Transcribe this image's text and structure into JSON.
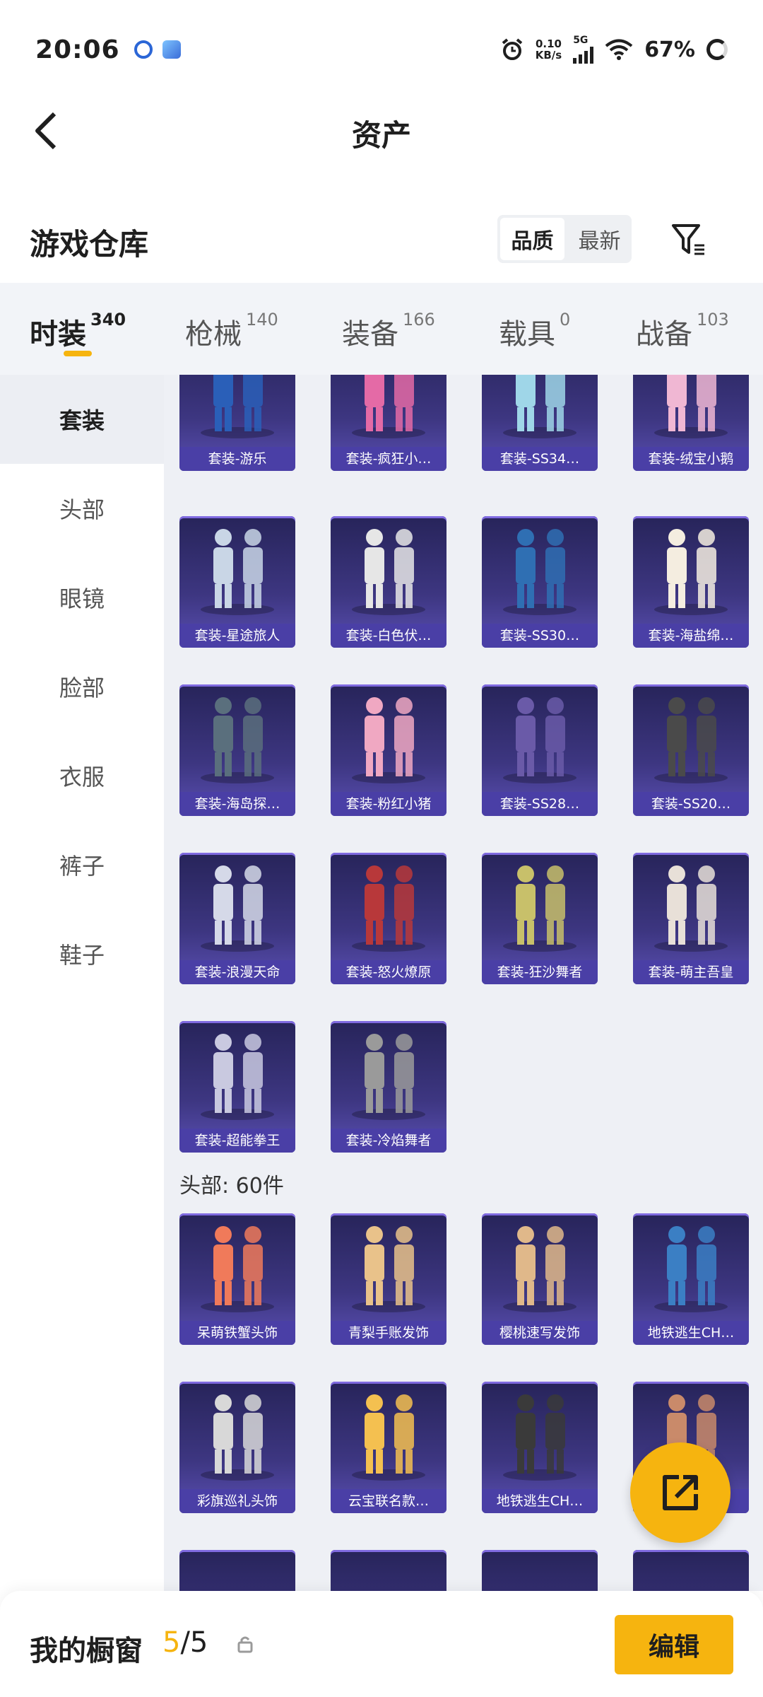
{
  "status_bar": {
    "time": "20:06",
    "net_speed_value": "0.10",
    "net_speed_unit": "KB/s",
    "network": "5G",
    "battery": "67%",
    "icons": [
      "app-notification-icon",
      "app-avatar-icon",
      "alarm-icon",
      "signal-icon",
      "wifi-icon",
      "battery-icon"
    ]
  },
  "nav": {
    "title": "资产",
    "back_icon": "chevron-left-icon"
  },
  "warehouse": {
    "title": "游戏仓库",
    "sort_options": [
      {
        "label": "品质",
        "active": true
      },
      {
        "label": "最新",
        "active": false
      }
    ],
    "filter_icon": "filter-icon"
  },
  "tabs": [
    {
      "label": "时装",
      "count": "340",
      "active": true
    },
    {
      "label": "枪械",
      "count": "140",
      "active": false
    },
    {
      "label": "装备",
      "count": "166",
      "active": false
    },
    {
      "label": "载具",
      "count": "0",
      "active": false
    },
    {
      "label": "战备",
      "count": "103",
      "active": false
    }
  ],
  "sidebar": {
    "items": [
      {
        "label": "套装",
        "active": true
      },
      {
        "label": "头部",
        "active": false
      },
      {
        "label": "眼镜",
        "active": false
      },
      {
        "label": "脸部",
        "active": false
      },
      {
        "label": "衣服",
        "active": false
      },
      {
        "label": "裤子",
        "active": false
      },
      {
        "label": "鞋子",
        "active": false
      }
    ]
  },
  "suits": [
    "套装-游乐",
    "套装-疯狂小…",
    "套装-SS34…",
    "套装-绒宝小鹅",
    "套装-星途旅人",
    "套装-白色伏…",
    "套装-SS30…",
    "套装-海盐绵…",
    "套装-海岛探…",
    "套装-粉红小猪",
    "套装-SS28…",
    "套装-SS20…",
    "套装-浪漫天命",
    "套装-怒火燎原",
    "套装-狂沙舞者",
    "套装-萌主吾皇",
    "套装-超能拳王",
    "套装-冷焰舞者"
  ],
  "head_section": {
    "label": "头部: 60件",
    "items": [
      "呆萌铁蟹头饰",
      "青梨手账发饰",
      "樱桃速写发饰",
      "地铁逃生CH…",
      "彩旗巡礼头饰",
      "云宝联名款…",
      "地铁逃生CH…",
      ""
    ]
  },
  "bottom_bar": {
    "label": "我的橱窗",
    "count_current": "5",
    "count_total": "/5",
    "edit_label": "编辑"
  },
  "colors": {
    "accent": "#f6b40f",
    "card_bg": "#3d3681",
    "caption_bg": "#4a3fa6"
  }
}
